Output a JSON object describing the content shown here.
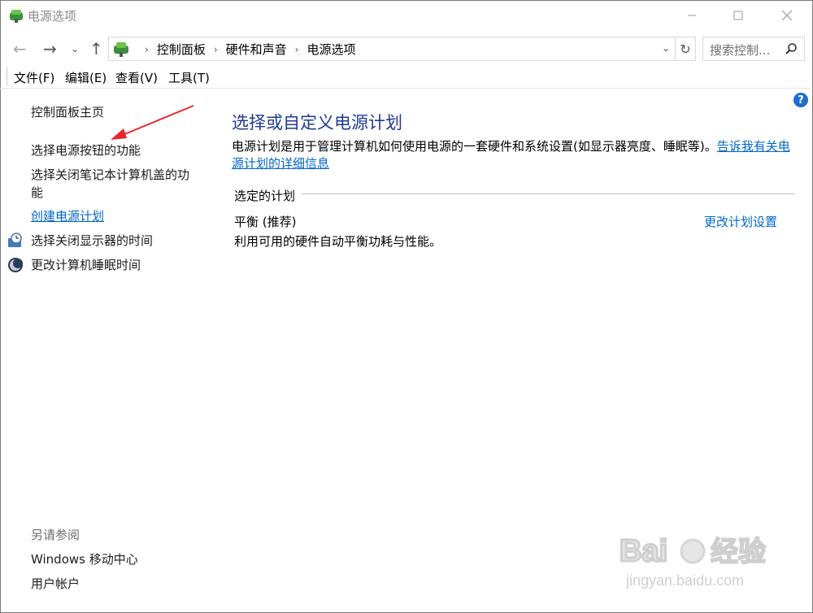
{
  "window": {
    "title": "电源选项"
  },
  "nav": {
    "breadcrumbs": [
      "控制面板",
      "硬件和声音",
      "电源选项"
    ],
    "search_placeholder": "搜索控制..."
  },
  "menu": {
    "items": [
      "文件(F)",
      "编辑(E)",
      "查看(V)",
      "工具(T)"
    ]
  },
  "sidebar": {
    "home": "控制面板主页",
    "items": [
      {
        "label": "选择电源按钮的功能",
        "icon": ""
      },
      {
        "label": "选择关闭笔记本计算机盖的功能",
        "icon": ""
      },
      {
        "label": "创建电源计划",
        "icon": ""
      },
      {
        "label": "选择关闭显示器的时间",
        "icon": "monitor-clock-icon"
      },
      {
        "label": "更改计算机睡眠时间",
        "icon": "moon-icon"
      }
    ],
    "see_also_heading": "另请参阅",
    "see_also": [
      "Windows 移动中心",
      "用户帐户"
    ]
  },
  "main": {
    "title": "选择或自定义电源计划",
    "description": "电源计划是用于管理计算机如何使用电源的一套硬件和系统设置(如显示器亮度、睡眠等)。",
    "description_link": "告诉我有关电源计划的详细信息",
    "section_label": "选定的计划",
    "plan": {
      "name": "平衡 (推荐)",
      "description": "利用可用的硬件自动平衡功耗与性能。",
      "change_link": "更改计划设置"
    }
  },
  "colors": {
    "accent_link": "#0066cc",
    "title_blue": "#1f3a93",
    "annotation_arrow": "#e8252b"
  },
  "watermark": {
    "text_top": "Baidu经验",
    "text_bottom": "jingyan.baidu.com"
  }
}
